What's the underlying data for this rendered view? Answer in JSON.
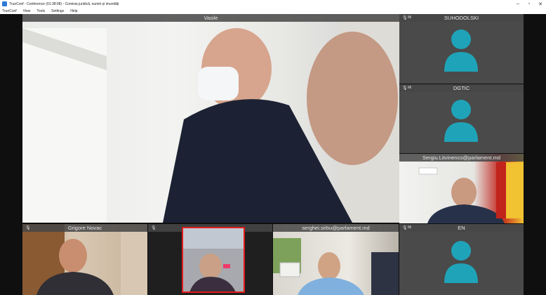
{
  "window": {
    "title": "TrueConf - Conference (01:38:08) - Comisia juridică, numiri și imunități",
    "controls": {
      "minimize": "–",
      "maximize": "▫",
      "close": "✕"
    }
  },
  "menu": {
    "items": [
      "TrueConf",
      "View",
      "Tools",
      "Settings",
      "Help"
    ]
  },
  "participants": {
    "main": {
      "name": "Vasile"
    },
    "suhodolski": {
      "name": "SUHODOLSKI",
      "badge": "Mi"
    },
    "dgtic": {
      "name": "DGTIC",
      "badge": "Mi"
    },
    "sergiu": {
      "name": "Sergiu.Litvinenco@parlament.md"
    },
    "grigore": {
      "name": "Grigore Novac"
    },
    "pm": {
      "name": "pm"
    },
    "serghei": {
      "name": "serghei.sirbu@parlament.md"
    },
    "en": {
      "name": "EN",
      "badge": "Mi"
    }
  },
  "colors": {
    "avatar": "#1fa3b8",
    "tile_bg": "#4a4a4a",
    "active_speaker_border": "#e01b1b"
  }
}
